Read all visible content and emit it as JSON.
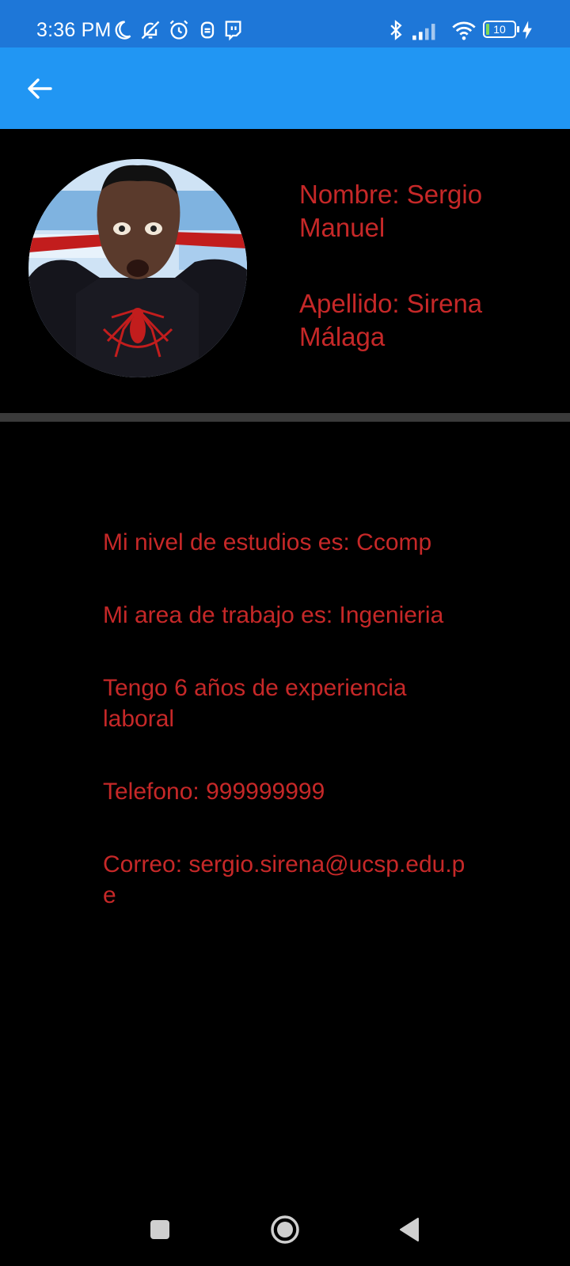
{
  "status_bar": {
    "time": "3:36 PM",
    "battery_level": "10",
    "icons_left": [
      "moon-icon",
      "bell-off-icon",
      "alarm-icon",
      "notification-app-icon",
      "twitch-icon"
    ],
    "icons_right": [
      "bluetooth-icon",
      "signal-icon",
      "wifi-icon",
      "battery-icon",
      "charging-icon"
    ]
  },
  "app_bar": {
    "color": "#2196f3",
    "back_icon": "arrow-left-icon"
  },
  "profile": {
    "avatar_icon": "profile-avatar",
    "name": "Nombre: Sergio Manuel",
    "surname": "Apellido: Sirena Málaga"
  },
  "details": {
    "education": "Mi nivel de estudios es:  Ccomp",
    "work_area": "Mi area de trabajo es:  Ingenieria",
    "experience": "Tengo 6 años de experiencia laboral",
    "phone": "Telefono:  999999999",
    "email": "Correo:  sergio.sirena@ucsp.edu.pe"
  },
  "colors": {
    "text_accent": "#c62828",
    "background": "#000000",
    "status_bar": "#1e77d8"
  },
  "nav_bar": {
    "icons": [
      "recents-icon",
      "home-icon",
      "back-triangle-icon"
    ]
  }
}
